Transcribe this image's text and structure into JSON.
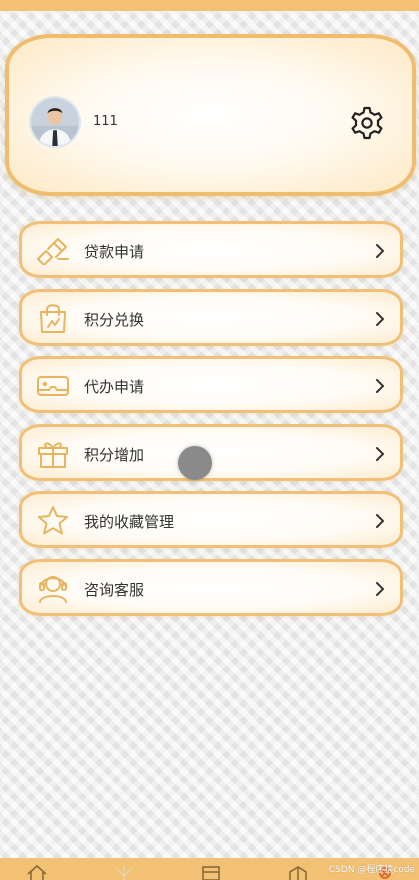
{
  "profile": {
    "username": "111",
    "avatar_icon": "user-avatar",
    "settings_icon": "gear-icon"
  },
  "menu": {
    "items": [
      {
        "label": "贷款申请",
        "icon": "loan-icon"
      },
      {
        "label": "积分兑换",
        "icon": "shopping-bag-icon"
      },
      {
        "label": "代办申请",
        "icon": "vr-glasses-icon"
      },
      {
        "label": "积分增加",
        "icon": "gift-icon"
      },
      {
        "label": "我的收藏管理",
        "icon": "star-icon"
      },
      {
        "label": "咨询客服",
        "icon": "customer-service-icon"
      }
    ],
    "chevron_icon": "chevron-right-icon"
  },
  "bottom_nav": {
    "tabs": [
      {
        "icon": "home-icon"
      },
      {
        "icon": "discover-icon"
      },
      {
        "icon": "calendar-icon"
      },
      {
        "icon": "category-icon"
      },
      {
        "icon": "profile-icon"
      }
    ],
    "watermark": "CSDN @程序猿code"
  },
  "colors": {
    "accent": "#f2c174",
    "card_border": "#f0bd6e",
    "icon_stroke": "#e8b45f",
    "background": "#ececec"
  }
}
